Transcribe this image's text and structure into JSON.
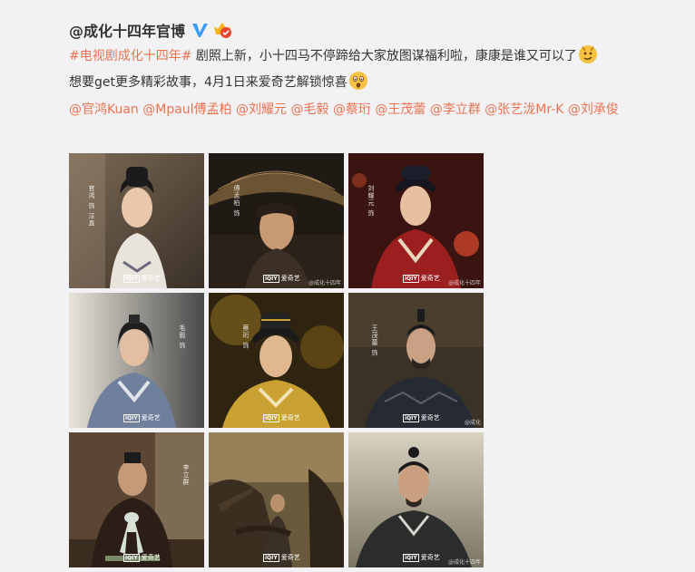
{
  "post": {
    "author": "@成化十四年官博",
    "hashtag": "#电视剧成化十四年#",
    "text1": " 剧照上新，小十四马不停蹄给大家放图谋福利啦，康康是谁又可以了",
    "text2": "想要get更多精彩故事，4月1日来爱奇艺解锁惊喜",
    "mentions": [
      "@官鸿Kuan",
      "@Mpaul傅孟柏",
      "@刘耀元",
      "@毛毅",
      "@蔡珩",
      "@王茂蕾",
      "@李立群",
      "@张艺泷Mr-K",
      "@刘承俊"
    ]
  },
  "colors": {
    "link": "#eb7350",
    "text": "#333333",
    "verified": "#3c9dfc",
    "background": "#f2f2f5"
  },
  "icons": {
    "verified": "verified-v-icon",
    "vip": "vip-crown-icon",
    "emoji1": "smirk-face-emoji",
    "emoji2": "surprised-face-emoji"
  },
  "photos": [
    {
      "name": "photo-1",
      "credit": "爱奇艺",
      "caption": "官鸿 饰 汪直"
    },
    {
      "name": "photo-2",
      "credit": "爱奇艺",
      "caption": "傅孟柏 饰",
      "watermark": "@成化十四年"
    },
    {
      "name": "photo-3",
      "credit": "爱奇艺",
      "caption": "刘耀元 饰",
      "watermark": "@成化十四年"
    },
    {
      "name": "photo-4",
      "credit": "爱奇艺",
      "caption": "毛毅 饰"
    },
    {
      "name": "photo-5",
      "credit": "爱奇艺",
      "caption": "蔡珩 饰"
    },
    {
      "name": "photo-6",
      "credit": "爱奇艺",
      "caption": "王茂蕾 饰",
      "watermark": "@成化"
    },
    {
      "name": "photo-7",
      "credit": "爱奇艺",
      "caption": "李立群"
    },
    {
      "name": "photo-8",
      "credit": "爱奇艺"
    },
    {
      "name": "photo-9",
      "credit": "爱奇艺",
      "watermark": "@成化十四年"
    }
  ]
}
